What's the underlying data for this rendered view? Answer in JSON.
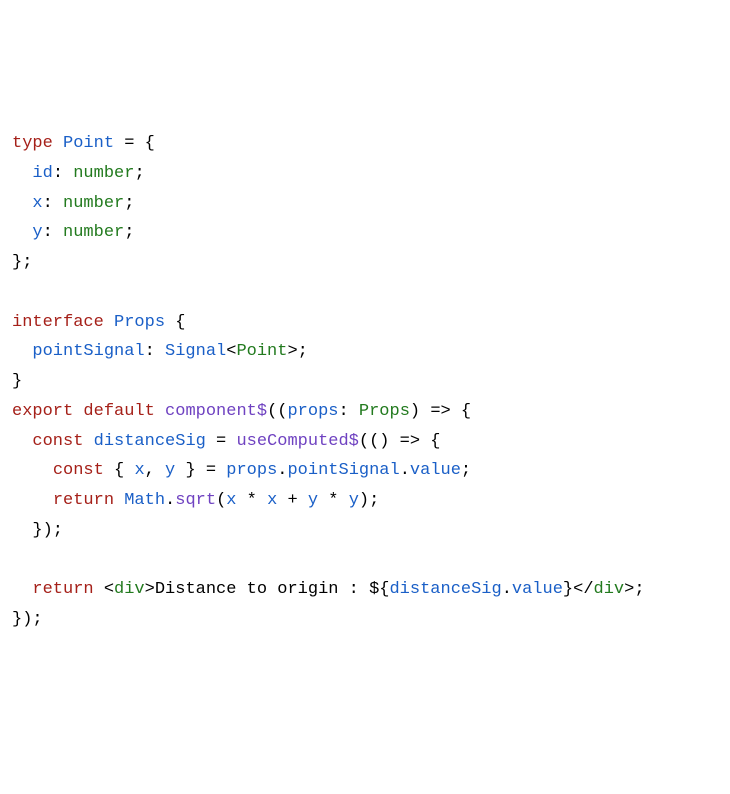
{
  "code": {
    "l1": {
      "kw_type": "type",
      "name": "Point",
      "eq": " = {"
    },
    "l2": {
      "indent": "  ",
      "prop": "id",
      "colon": ": ",
      "t": "number",
      "semi": ";"
    },
    "l3": {
      "indent": "  ",
      "prop": "x",
      "colon": ": ",
      "t": "number",
      "semi": ";"
    },
    "l4": {
      "indent": "  ",
      "prop": "y",
      "colon": ": ",
      "t": "number",
      "semi": ";"
    },
    "l5": {
      "close": "};"
    },
    "l6": {
      "blank": ""
    },
    "l7": {
      "kw_interface": "interface",
      "name": "Props",
      "open": " {"
    },
    "l8": {
      "indent": "  ",
      "prop": "pointSignal",
      "colon": ": ",
      "sig": "Signal",
      "lt": "<",
      "point": "Point",
      "gt": ">;"
    },
    "l9": {
      "close": "}"
    },
    "l10": {
      "kw_export": "export",
      "kw_default": "default",
      "fn": "component$",
      "open": "((",
      "param": "props",
      "colon": ": ",
      "ptype": "Props",
      "arrow": ") => {"
    },
    "l11": {
      "indent": "  ",
      "kw_const": "const",
      "name": "distanceSig",
      "eq": " = ",
      "fn": "useComputed$",
      "tail": "(() => {"
    },
    "l12": {
      "indent": "    ",
      "kw_const": "const",
      "open": " { ",
      "x": "x",
      "comma": ", ",
      "y": "y",
      "close": " } = ",
      "props": "props",
      "dot1": ".",
      "ps": "pointSignal",
      "dot2": ".",
      "val": "value",
      "semi": ";"
    },
    "l13": {
      "indent": "    ",
      "kw_return": "return",
      "sp": " ",
      "math": "Math",
      "dot": ".",
      "sqrt": "sqrt",
      "open": "(",
      "x1": "x",
      "mul1": " * ",
      "x2": "x",
      "plus": " + ",
      "y1": "y",
      "mul2": " * ",
      "y2": "y",
      "close": ");"
    },
    "l14": {
      "indent": "  ",
      "close": "});"
    },
    "l15": {
      "blank": ""
    },
    "l16": {
      "indent": "  ",
      "kw_return": "return",
      "sp": " ",
      "lt": "<",
      "tag": "div",
      "gt": ">",
      "text": "Distance to origin : $",
      "ob": "{",
      "ds": "distanceSig",
      "dot": ".",
      "val": "value",
      "cb": "}",
      "lt2": "</",
      "tag2": "div",
      "gt2": ">;"
    },
    "l17": {
      "close": "});"
    }
  }
}
